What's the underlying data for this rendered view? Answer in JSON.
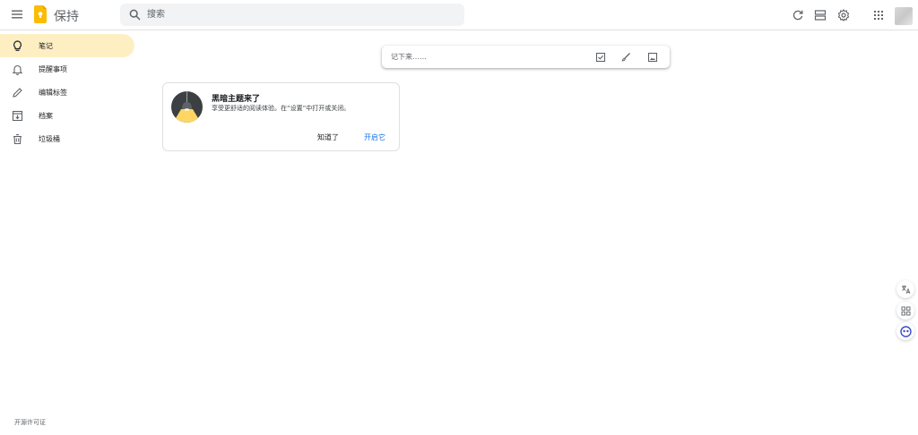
{
  "header": {
    "app_title": "保持",
    "search_placeholder": "搜索"
  },
  "sidebar": {
    "items": [
      {
        "label": "笔记",
        "icon": "lightbulb-icon",
        "active": true
      },
      {
        "label": "提醒事项",
        "icon": "bell-icon",
        "active": false
      },
      {
        "label": "编辑标签",
        "icon": "pencil-icon",
        "active": false
      },
      {
        "label": "档案",
        "icon": "archive-icon",
        "active": false
      },
      {
        "label": "垃圾桶",
        "icon": "trash-icon",
        "active": false
      }
    ],
    "footer_link": "开源许可证"
  },
  "note_bar": {
    "placeholder": "记下来……"
  },
  "dark_theme_card": {
    "title": "黑暗主题来了",
    "description": "享受更舒适的阅读体验。在“设置”中打开或关闭。",
    "dismiss_label": "知道了",
    "enable_label": "开启它"
  },
  "colors": {
    "active_nav_bg": "#feefc3",
    "brand_yellow": "#fbbc04",
    "link_blue": "#1a73e8",
    "search_bg": "#f1f3f4"
  }
}
